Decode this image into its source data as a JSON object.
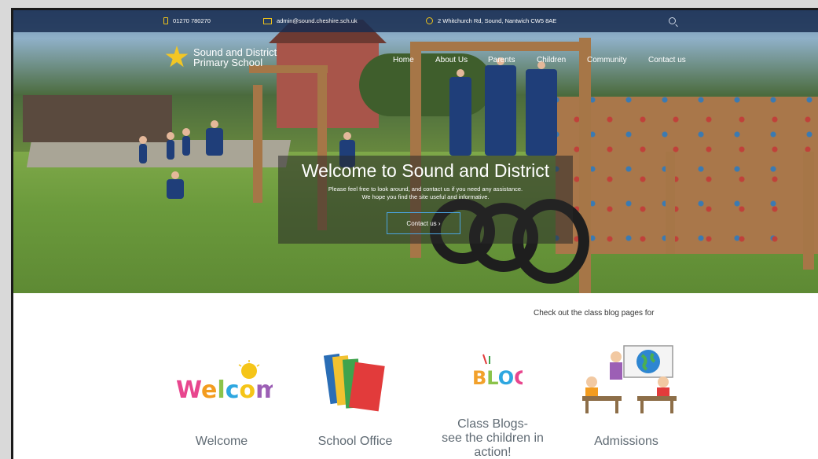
{
  "topbar": {
    "phone": "01270 780270",
    "email": "admin@sound.cheshire.sch.uk",
    "address": "2 Whitchurch Rd, Sound, Nantwich CW5 8AE"
  },
  "logo": {
    "line1": "Sound and District",
    "line2": "Primary School"
  },
  "nav": {
    "home": "Home",
    "about": "About Us",
    "parents": "Parents",
    "children": "Children",
    "community": "Community",
    "contact": "Contact us"
  },
  "hero": {
    "title": "Welcome to Sound and District",
    "line1": "Please feel free to look around, and contact us if you need any assistance.",
    "line2": "We hope you find the site useful and informative.",
    "cta": "Contact us ›"
  },
  "blog_note": "Check out the class blog pages for",
  "tiles": {
    "welcome": "Welcome",
    "office": "School Office",
    "blogs_line1": "Class Blogs-",
    "blogs_line2": "see the children in",
    "blogs_line3": "action!",
    "admissions": "Admissions"
  },
  "images": {
    "welcome_word": "Welcome",
    "blog_word": "BLOG"
  },
  "colors": {
    "topbar": "#1e3558",
    "accent": "#f0c419",
    "cta_border": "#4aa3df"
  }
}
